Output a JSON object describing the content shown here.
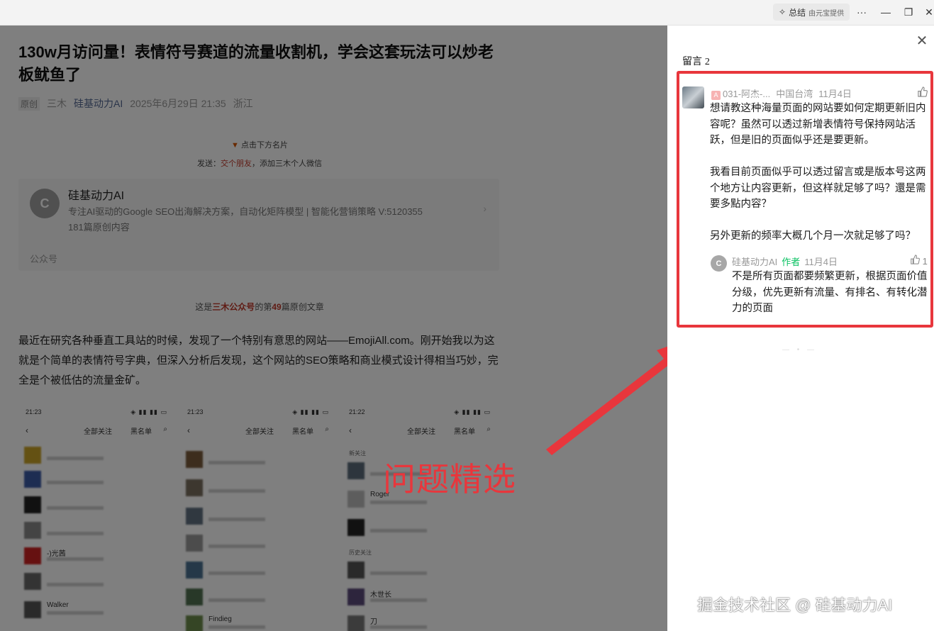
{
  "browser": {
    "summary_label": "总结",
    "summary_sub": "由元宝提供",
    "more_glyph": "···",
    "minimize_glyph": "—",
    "restore_glyph": "❐",
    "close_glyph": "✕"
  },
  "article": {
    "title": "130w月访问量！表情符号赛道的流量收割机，学会这套玩法可以炒老板鱿鱼了",
    "tag": "原创",
    "author": "三木",
    "account": "硅基动力AI",
    "date": "2025年6月29日 21:35",
    "location": "浙江",
    "card_tip": "点击下方名片",
    "card_tip2_prefix": "发送：",
    "card_tip2_highlight": "交个朋友",
    "card_tip2_suffix": "，添加三木个人微信",
    "card": {
      "logo_text": "C",
      "name": "硅基动力AI",
      "desc": "专注AI驱动的Google SEO出海解决方案，自动化矩阵模型 | 智能化营销策略 V:5120355",
      "count": "181篇原创内容",
      "footer": "公众号",
      "arrow": "›"
    },
    "orig_prefix": "这是",
    "orig_account": "三木公众号",
    "orig_mid": "的第",
    "orig_number": "49",
    "orig_suffix": "篇原创文章",
    "paragraph": "最近在研究各种垂直工具站的时候，发现了一个特别有意思的网站——EmojiAll.com。刚开始我以为这就是个简单的表情符号字典，但深入分析后发现，这个网站的SEO策略和商业模式设计得相当巧妙，完全是个被低估的流量金矿。"
  },
  "phones": [
    {
      "time": "21:23",
      "status_icons": "◈ ▮▮ ▮▮ ▭",
      "back": "‹",
      "tab1": "全部关注",
      "tab2": "黑名单",
      "search": "⌕",
      "rows": [
        "",
        "",
        "",
        "",
        "-)光茜",
        "",
        "Walker"
      ]
    },
    {
      "time": "21:23",
      "status_icons": "◈ ▮▮ ▮▮ ▭",
      "back": "‹",
      "tab1": "全部关注",
      "tab2": "黑名单",
      "search": "⌕",
      "rows": [
        "",
        "",
        "",
        "",
        "",
        "",
        "Findieg"
      ]
    },
    {
      "time": "21:22",
      "status_icons": "◈ ▮▮ ▮▮ ▭",
      "back": "‹",
      "tab1": "全部关注",
      "tab2": "黑名单",
      "search": "⌕",
      "section1": "新关注",
      "section2": "历史关注",
      "rows": [
        "",
        "Roger",
        "",
        "",
        "木世长",
        "刀"
      ]
    }
  ],
  "overlay": {
    "label": "问题精选",
    "color": "#e8363c"
  },
  "comments": {
    "title": "留言",
    "count": "2",
    "close_glyph": "✕",
    "comment": {
      "badge": "A",
      "user": "031-阿杰-...",
      "region": "中国台湾",
      "date": "11月4日",
      "like_icon": "thumbs-up-icon",
      "paragraphs": [
        "想请教这种海量页面的网站要如何定期更新旧内容呢？虽然可以透过新增表情符号保持网站活跃，但是旧的页面似乎还是要更新。",
        "我看目前页面似乎可以透过留言或是版本号这两个地方让内容更新，但这样就足够了吗？還是需要多點内容？",
        "另外更新的频率大概几个月一次就足够了吗？"
      ]
    },
    "reply": {
      "logo_text": "C",
      "user": "硅基动力AI",
      "role": "作者",
      "date": "11月4日",
      "likes": "1",
      "text": "不是所有页面都要频繁更新，根据页面价值分级，优先更新有流量、有排名、有转化潜力的页面"
    },
    "loading": "— • —"
  },
  "watermark": "掘金技术社区 @ 硅基动力AI"
}
